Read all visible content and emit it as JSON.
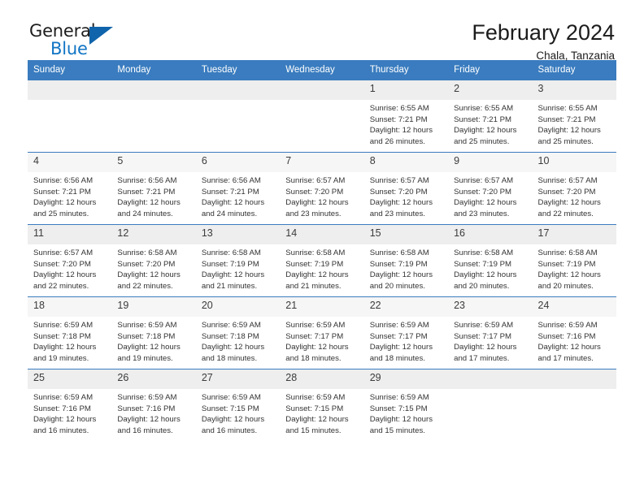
{
  "brand": {
    "word_top": "General",
    "word_bottom": "Blue",
    "triangle_icon": "triangle-logo-icon",
    "accent_color": "#1275c4",
    "triangle_color": "#1064ab"
  },
  "header": {
    "title": "February 2024",
    "subtitle": "Chala, Tanzania"
  },
  "calendar": {
    "header_bg": "#3a7cbf",
    "weekday_headers": [
      "Sunday",
      "Monday",
      "Tuesday",
      "Wednesday",
      "Thursday",
      "Friday",
      "Saturday"
    ],
    "labels": {
      "sunrise": "Sunrise:",
      "sunset": "Sunset:",
      "daylight": "Daylight:"
    },
    "weeks": [
      [
        {
          "day": "",
          "blank": true
        },
        {
          "day": "",
          "blank": true
        },
        {
          "day": "",
          "blank": true
        },
        {
          "day": "",
          "blank": true
        },
        {
          "day": "1",
          "sunrise": "Sunrise: 6:55 AM",
          "sunset": "Sunset: 7:21 PM",
          "daylight1": "Daylight: 12 hours",
          "daylight2": "and 26 minutes."
        },
        {
          "day": "2",
          "sunrise": "Sunrise: 6:55 AM",
          "sunset": "Sunset: 7:21 PM",
          "daylight1": "Daylight: 12 hours",
          "daylight2": "and 25 minutes."
        },
        {
          "day": "3",
          "sunrise": "Sunrise: 6:55 AM",
          "sunset": "Sunset: 7:21 PM",
          "daylight1": "Daylight: 12 hours",
          "daylight2": "and 25 minutes."
        }
      ],
      [
        {
          "day": "4",
          "sunrise": "Sunrise: 6:56 AM",
          "sunset": "Sunset: 7:21 PM",
          "daylight1": "Daylight: 12 hours",
          "daylight2": "and 25 minutes."
        },
        {
          "day": "5",
          "sunrise": "Sunrise: 6:56 AM",
          "sunset": "Sunset: 7:21 PM",
          "daylight1": "Daylight: 12 hours",
          "daylight2": "and 24 minutes."
        },
        {
          "day": "6",
          "sunrise": "Sunrise: 6:56 AM",
          "sunset": "Sunset: 7:21 PM",
          "daylight1": "Daylight: 12 hours",
          "daylight2": "and 24 minutes."
        },
        {
          "day": "7",
          "sunrise": "Sunrise: 6:57 AM",
          "sunset": "Sunset: 7:20 PM",
          "daylight1": "Daylight: 12 hours",
          "daylight2": "and 23 minutes."
        },
        {
          "day": "8",
          "sunrise": "Sunrise: 6:57 AM",
          "sunset": "Sunset: 7:20 PM",
          "daylight1": "Daylight: 12 hours",
          "daylight2": "and 23 minutes."
        },
        {
          "day": "9",
          "sunrise": "Sunrise: 6:57 AM",
          "sunset": "Sunset: 7:20 PM",
          "daylight1": "Daylight: 12 hours",
          "daylight2": "and 23 minutes."
        },
        {
          "day": "10",
          "sunrise": "Sunrise: 6:57 AM",
          "sunset": "Sunset: 7:20 PM",
          "daylight1": "Daylight: 12 hours",
          "daylight2": "and 22 minutes."
        }
      ],
      [
        {
          "day": "11",
          "sunrise": "Sunrise: 6:57 AM",
          "sunset": "Sunset: 7:20 PM",
          "daylight1": "Daylight: 12 hours",
          "daylight2": "and 22 minutes."
        },
        {
          "day": "12",
          "sunrise": "Sunrise: 6:58 AM",
          "sunset": "Sunset: 7:20 PM",
          "daylight1": "Daylight: 12 hours",
          "daylight2": "and 22 minutes."
        },
        {
          "day": "13",
          "sunrise": "Sunrise: 6:58 AM",
          "sunset": "Sunset: 7:19 PM",
          "daylight1": "Daylight: 12 hours",
          "daylight2": "and 21 minutes."
        },
        {
          "day": "14",
          "sunrise": "Sunrise: 6:58 AM",
          "sunset": "Sunset: 7:19 PM",
          "daylight1": "Daylight: 12 hours",
          "daylight2": "and 21 minutes."
        },
        {
          "day": "15",
          "sunrise": "Sunrise: 6:58 AM",
          "sunset": "Sunset: 7:19 PM",
          "daylight1": "Daylight: 12 hours",
          "daylight2": "and 20 minutes."
        },
        {
          "day": "16",
          "sunrise": "Sunrise: 6:58 AM",
          "sunset": "Sunset: 7:19 PM",
          "daylight1": "Daylight: 12 hours",
          "daylight2": "and 20 minutes."
        },
        {
          "day": "17",
          "sunrise": "Sunrise: 6:58 AM",
          "sunset": "Sunset: 7:19 PM",
          "daylight1": "Daylight: 12 hours",
          "daylight2": "and 20 minutes."
        }
      ],
      [
        {
          "day": "18",
          "sunrise": "Sunrise: 6:59 AM",
          "sunset": "Sunset: 7:18 PM",
          "daylight1": "Daylight: 12 hours",
          "daylight2": "and 19 minutes."
        },
        {
          "day": "19",
          "sunrise": "Sunrise: 6:59 AM",
          "sunset": "Sunset: 7:18 PM",
          "daylight1": "Daylight: 12 hours",
          "daylight2": "and 19 minutes."
        },
        {
          "day": "20",
          "sunrise": "Sunrise: 6:59 AM",
          "sunset": "Sunset: 7:18 PM",
          "daylight1": "Daylight: 12 hours",
          "daylight2": "and 18 minutes."
        },
        {
          "day": "21",
          "sunrise": "Sunrise: 6:59 AM",
          "sunset": "Sunset: 7:17 PM",
          "daylight1": "Daylight: 12 hours",
          "daylight2": "and 18 minutes."
        },
        {
          "day": "22",
          "sunrise": "Sunrise: 6:59 AM",
          "sunset": "Sunset: 7:17 PM",
          "daylight1": "Daylight: 12 hours",
          "daylight2": "and 18 minutes."
        },
        {
          "day": "23",
          "sunrise": "Sunrise: 6:59 AM",
          "sunset": "Sunset: 7:17 PM",
          "daylight1": "Daylight: 12 hours",
          "daylight2": "and 17 minutes."
        },
        {
          "day": "24",
          "sunrise": "Sunrise: 6:59 AM",
          "sunset": "Sunset: 7:16 PM",
          "daylight1": "Daylight: 12 hours",
          "daylight2": "and 17 minutes."
        }
      ],
      [
        {
          "day": "25",
          "sunrise": "Sunrise: 6:59 AM",
          "sunset": "Sunset: 7:16 PM",
          "daylight1": "Daylight: 12 hours",
          "daylight2": "and 16 minutes."
        },
        {
          "day": "26",
          "sunrise": "Sunrise: 6:59 AM",
          "sunset": "Sunset: 7:16 PM",
          "daylight1": "Daylight: 12 hours",
          "daylight2": "and 16 minutes."
        },
        {
          "day": "27",
          "sunrise": "Sunrise: 6:59 AM",
          "sunset": "Sunset: 7:15 PM",
          "daylight1": "Daylight: 12 hours",
          "daylight2": "and 16 minutes."
        },
        {
          "day": "28",
          "sunrise": "Sunrise: 6:59 AM",
          "sunset": "Sunset: 7:15 PM",
          "daylight1": "Daylight: 12 hours",
          "daylight2": "and 15 minutes."
        },
        {
          "day": "29",
          "sunrise": "Sunrise: 6:59 AM",
          "sunset": "Sunset: 7:15 PM",
          "daylight1": "Daylight: 12 hours",
          "daylight2": "and 15 minutes."
        },
        {
          "day": "",
          "blank": true
        },
        {
          "day": "",
          "blank": true
        }
      ]
    ]
  }
}
